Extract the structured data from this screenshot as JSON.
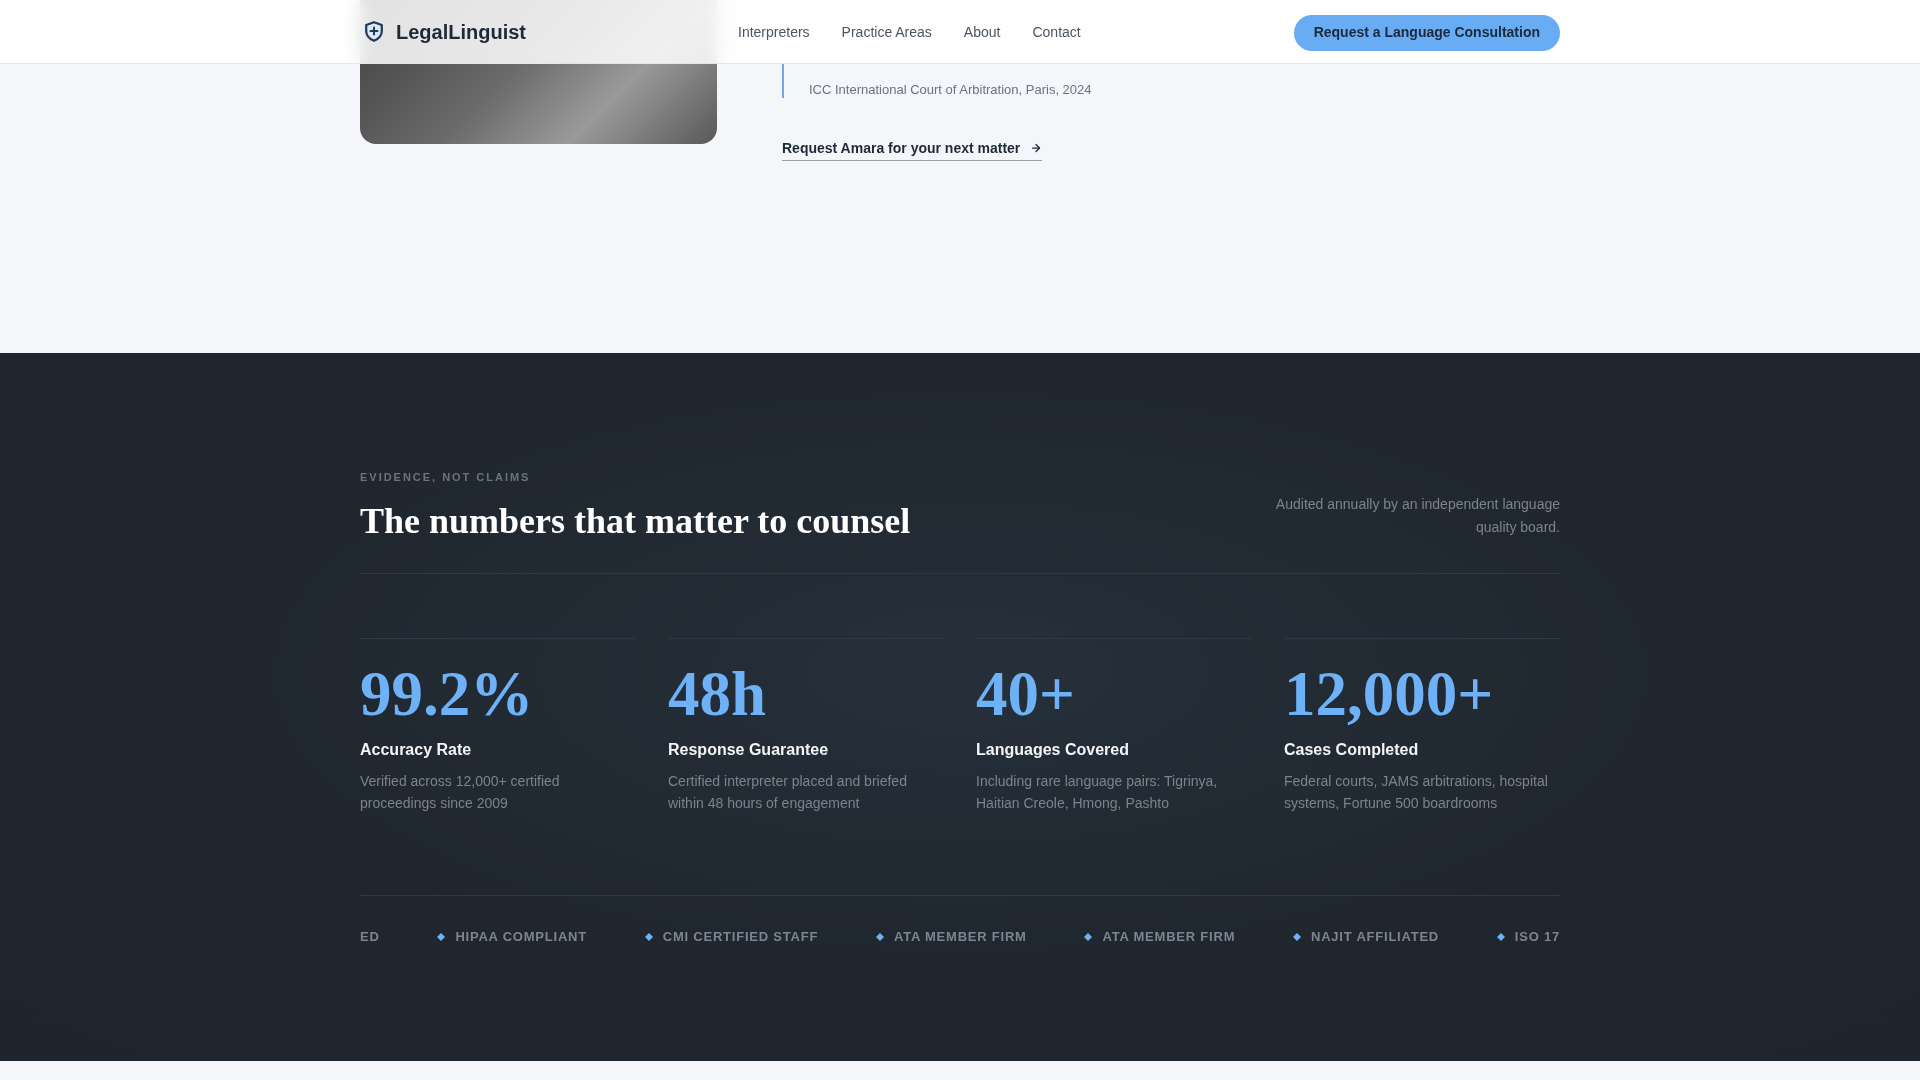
{
  "header": {
    "brand": "LegalLinguist",
    "nav": [
      "Interpreters",
      "Practice Areas",
      "About",
      "Contact"
    ],
    "cta": "Request a Language Consultation"
  },
  "profile": {
    "quote_source": "ICC International Court of Arbitration, Paris, 2024",
    "link": "Request Amara for your next matter"
  },
  "stats_section": {
    "eyebrow": "EVIDENCE, NOT CLAIMS",
    "title": "The numbers that matter to counsel",
    "note": "Audited annually by an independent language quality board.",
    "stats": [
      {
        "value": "99.2%",
        "label": "Accuracy Rate",
        "description": "Verified across 12,000+ certified proceedings since 2009"
      },
      {
        "value": "48h",
        "label": "Response Guarantee",
        "description": "Certified interpreter placed and briefed within 48 hours of engagement"
      },
      {
        "value": "40+",
        "label": "Languages Covered",
        "description": "Including rare language pairs: Tigrinya, Haitian Creole, Hmong, Pashto"
      },
      {
        "value": "12,000+",
        "label": "Cases Completed",
        "description": "Federal courts, JAMS arbitrations, hospital systems, Fortune 500 boardrooms"
      }
    ],
    "ticker": [
      {
        "text": "ED",
        "marker": false
      },
      {
        "text": "HIPAA COMPLIANT",
        "marker": true
      },
      {
        "text": "CMI CERTIFIED STAFF",
        "marker": true
      },
      {
        "text": "ATA MEMBER FIRM",
        "marker": true
      },
      {
        "text": "ATA MEMBER FIRM",
        "marker": true
      },
      {
        "text": "NAJIT AFFILIATED",
        "marker": true
      },
      {
        "text": "ISO 17",
        "marker": true
      }
    ]
  }
}
